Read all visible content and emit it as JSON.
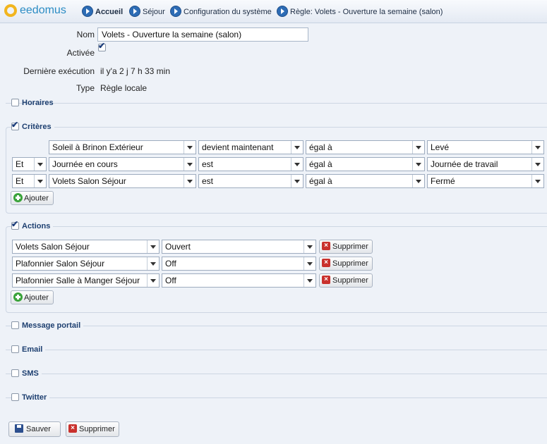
{
  "app": {
    "logo_text": "eedomus"
  },
  "breadcrumb": [
    {
      "label": "Accueil"
    },
    {
      "label": "Séjour"
    },
    {
      "label": "Configuration du système"
    },
    {
      "label": "Règle: Volets - Ouverture la semaine (salon)"
    }
  ],
  "form": {
    "nom_label": "Nom",
    "nom_value": "Volets - Ouverture la semaine (salon)",
    "active_label": "Activée",
    "active_checked": true,
    "last_exec_label": "Dernière exécution",
    "last_exec_value": "il y'a 2 j 7 h 33 min",
    "type_label": "Type",
    "type_value": "Règle locale"
  },
  "sections": {
    "horaires": {
      "label": "Horaires",
      "checked": false
    },
    "criteres": {
      "label": "Critères",
      "checked": true
    },
    "actions": {
      "label": "Actions",
      "checked": true
    },
    "message": {
      "label": "Message portail",
      "checked": false
    },
    "email": {
      "label": "Email",
      "checked": false
    },
    "sms": {
      "label": "SMS",
      "checked": false
    },
    "twitter": {
      "label": "Twitter",
      "checked": false
    }
  },
  "criteres": {
    "rows": [
      {
        "connector": "",
        "device": "Soleil à Brinon Extérieur",
        "condition": "devient maintenant",
        "operator": "égal à",
        "value": "Levé"
      },
      {
        "connector": "Et",
        "device": "Journée en cours",
        "condition": "est",
        "operator": "égal à",
        "value": "Journée de travail"
      },
      {
        "connector": "Et",
        "device": "Volets Salon Séjour",
        "condition": "est",
        "operator": "égal à",
        "value": "Fermé"
      }
    ],
    "add_label": "Ajouter"
  },
  "actions": {
    "rows": [
      {
        "device": "Volets Salon Séjour",
        "value": "Ouvert",
        "delete_label": "Supprimer"
      },
      {
        "device": "Plafonnier Salon Séjour",
        "value": "Off",
        "delete_label": "Supprimer"
      },
      {
        "device": "Plafonnier Salle à Manger Séjour",
        "value": "Off",
        "delete_label": "Supprimer"
      }
    ],
    "add_label": "Ajouter"
  },
  "footer": {
    "save_label": "Sauver",
    "delete_label": "Supprimer"
  },
  "colors": {
    "section_title": "#1d3f70",
    "add_icon": "#3aa33a",
    "delete_icon": "#c9302c",
    "background": "#eef2f8"
  }
}
